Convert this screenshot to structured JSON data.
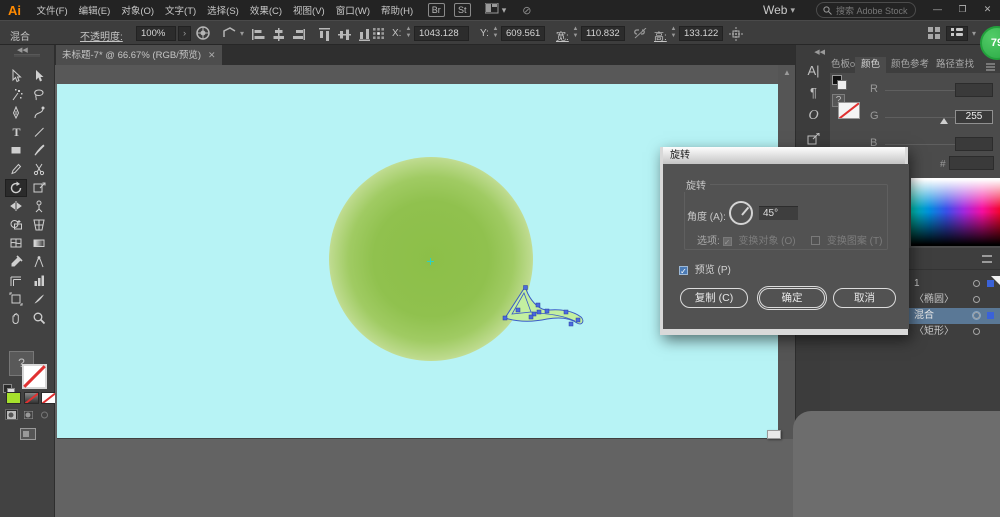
{
  "menubar": {
    "logo": "Ai",
    "items": [
      {
        "label": "文件(F)"
      },
      {
        "label": "编辑(E)"
      },
      {
        "label": "对象(O)"
      },
      {
        "label": "文字(T)"
      },
      {
        "label": "选择(S)"
      },
      {
        "label": "效果(C)"
      },
      {
        "label": "视图(V)"
      },
      {
        "label": "窗口(W)"
      },
      {
        "label": "帮助(H)"
      }
    ],
    "bridge_label": "Br",
    "stock_label": "St",
    "workspace_label": "Web",
    "search_placeholder": "搜索 Adobe Stock",
    "window_buttons": {
      "minimize": "—",
      "restore": "❐",
      "close": "✕"
    }
  },
  "optionsbar": {
    "context_label": "混合",
    "opacity_label": "不透明度:",
    "opacity_value": "100%",
    "x_label": "X:",
    "x_value": "1043.128",
    "y_label": "Y:",
    "y_value": "609.561",
    "w_label": "宽:",
    "w_value": "110.832",
    "h_label": "高:",
    "h_value": "133.122"
  },
  "doc_tab": {
    "title": "未标题-7* @ 66.67% (RGB/预览)",
    "close": "✕"
  },
  "toolbar": {
    "tools": [
      {
        "name": "selection",
        "icon": "arrow-outline"
      },
      {
        "name": "direct-selection",
        "icon": "arrow-filled"
      },
      {
        "name": "magic-wand",
        "icon": "wand"
      },
      {
        "name": "lasso",
        "icon": "lasso"
      },
      {
        "name": "pen",
        "icon": "pen"
      },
      {
        "name": "curvature",
        "icon": "curvature"
      },
      {
        "name": "type",
        "icon": "type"
      },
      {
        "name": "line-segment",
        "icon": "line"
      },
      {
        "name": "rectangle",
        "icon": "rect"
      },
      {
        "name": "paintbrush",
        "icon": "brush"
      },
      {
        "name": "shaper",
        "icon": "pencil"
      },
      {
        "name": "scissors",
        "icon": "scissors"
      },
      {
        "name": "rotate",
        "icon": "rotate",
        "selected": true
      },
      {
        "name": "free-transform",
        "icon": "freetransform"
      },
      {
        "name": "width",
        "icon": "width"
      },
      {
        "name": "puppet-warp",
        "icon": "puppet"
      },
      {
        "name": "shape-builder",
        "icon": "shapebuilder"
      },
      {
        "name": "perspective-grid",
        "icon": "perspective"
      },
      {
        "name": "mesh",
        "icon": "mesh"
      },
      {
        "name": "gradient",
        "icon": "gradient"
      },
      {
        "name": "eyedropper",
        "icon": "eyedropper"
      },
      {
        "name": "symbol-sprayer",
        "icon": "symbol"
      },
      {
        "name": "slice",
        "icon": "slice"
      },
      {
        "name": "graph",
        "icon": "graph"
      },
      {
        "name": "artboard",
        "icon": "artboard"
      },
      {
        "name": "knife",
        "icon": "knife"
      },
      {
        "name": "hand",
        "icon": "hand"
      },
      {
        "name": "zoom",
        "icon": "zoom"
      }
    ],
    "fill_question": "?"
  },
  "dialog": {
    "title": "旋转",
    "group_label": "旋转",
    "angle_label": "角度 (A):",
    "angle_value": "45°",
    "options_label": "选项:",
    "option_objects": "变换对象 (O)",
    "option_patterns": "变换图案 (T)",
    "preview_label": "预览 (P)",
    "copy_label": "复制 (C)",
    "ok_label": "确定",
    "cancel_label": "取消"
  },
  "right_panel": {
    "tabs": [
      {
        "label": "色板"
      },
      {
        "label": "颜色",
        "active": true
      },
      {
        "label": "颜色参考"
      },
      {
        "label": "路径查找"
      }
    ],
    "r_label": "R",
    "g_label": "G",
    "b_label": "B",
    "g_value": "255",
    "hex_label": "#"
  },
  "layers": {
    "rows": [
      {
        "label": "1",
        "selsq": true
      },
      {
        "label": "〈椭圆〉"
      },
      {
        "label": "混合",
        "selected": true,
        "selsq": true,
        "boxed": true
      },
      {
        "label": "〈矩形〉"
      }
    ]
  },
  "badge": {
    "text": "79"
  },
  "canvas": {
    "artboard_color": "#b7f3f5",
    "circle_gradient_center": "#8fc050",
    "shape_fill": "#b9ec83",
    "selection_color": "#3a5bc7"
  }
}
